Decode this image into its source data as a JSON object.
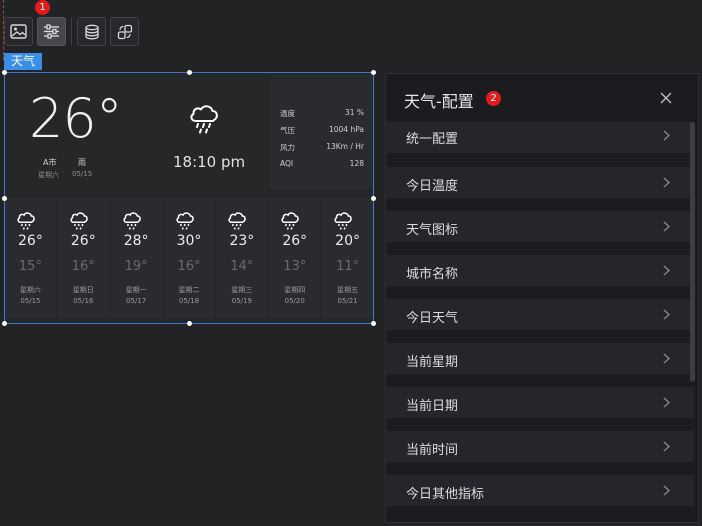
{
  "toolbar": {
    "buttons": [
      {
        "icon": "image-icon"
      },
      {
        "icon": "settings-sliders-icon",
        "active": true
      },
      {
        "icon": "database-icon"
      },
      {
        "icon": "link-exchange-icon"
      }
    ],
    "badge": "1"
  },
  "widget": {
    "tag": "天气",
    "current": {
      "temp": "26°",
      "city": "A市",
      "condition": "雨",
      "weekday": "星期六",
      "date": "05/15",
      "time": "18:10 pm",
      "icon": "rain-cloud-icon"
    },
    "metrics": [
      {
        "label": "温度",
        "value": "31 %"
      },
      {
        "label": "气压",
        "value": "1004 hPa"
      },
      {
        "label": "风力",
        "value": "13Km / Hr"
      },
      {
        "label": "AQI",
        "value": "128"
      }
    ],
    "forecast": [
      {
        "high": "26°",
        "low": "15°",
        "weekday": "星期六",
        "date": "05/15"
      },
      {
        "high": "26°",
        "low": "16°",
        "weekday": "星期日",
        "date": "05/16"
      },
      {
        "high": "28°",
        "low": "19°",
        "weekday": "星期一",
        "date": "05/17"
      },
      {
        "high": "30°",
        "low": "16°",
        "weekday": "星期二",
        "date": "05/18"
      },
      {
        "high": "23°",
        "low": "14°",
        "weekday": "星期三",
        "date": "05/19"
      },
      {
        "high": "26°",
        "low": "13°",
        "weekday": "星期四",
        "date": "05/20"
      },
      {
        "high": "20°",
        "low": "11°",
        "weekday": "星期五",
        "date": "05/21"
      }
    ]
  },
  "panel": {
    "title": "天气-配置",
    "badge": "2",
    "items": [
      {
        "label": "统一配置"
      },
      {
        "label": "今日温度"
      },
      {
        "label": "天气图标"
      },
      {
        "label": "城市名称"
      },
      {
        "label": "今日天气"
      },
      {
        "label": "当前星期"
      },
      {
        "label": "当前日期"
      },
      {
        "label": "当前时间"
      },
      {
        "label": "今日其他指标"
      }
    ]
  },
  "colors": {
    "accent": "#3a8ee6",
    "badge": "#e21b1b",
    "background": "#222325",
    "panel": "#1b1c20"
  }
}
